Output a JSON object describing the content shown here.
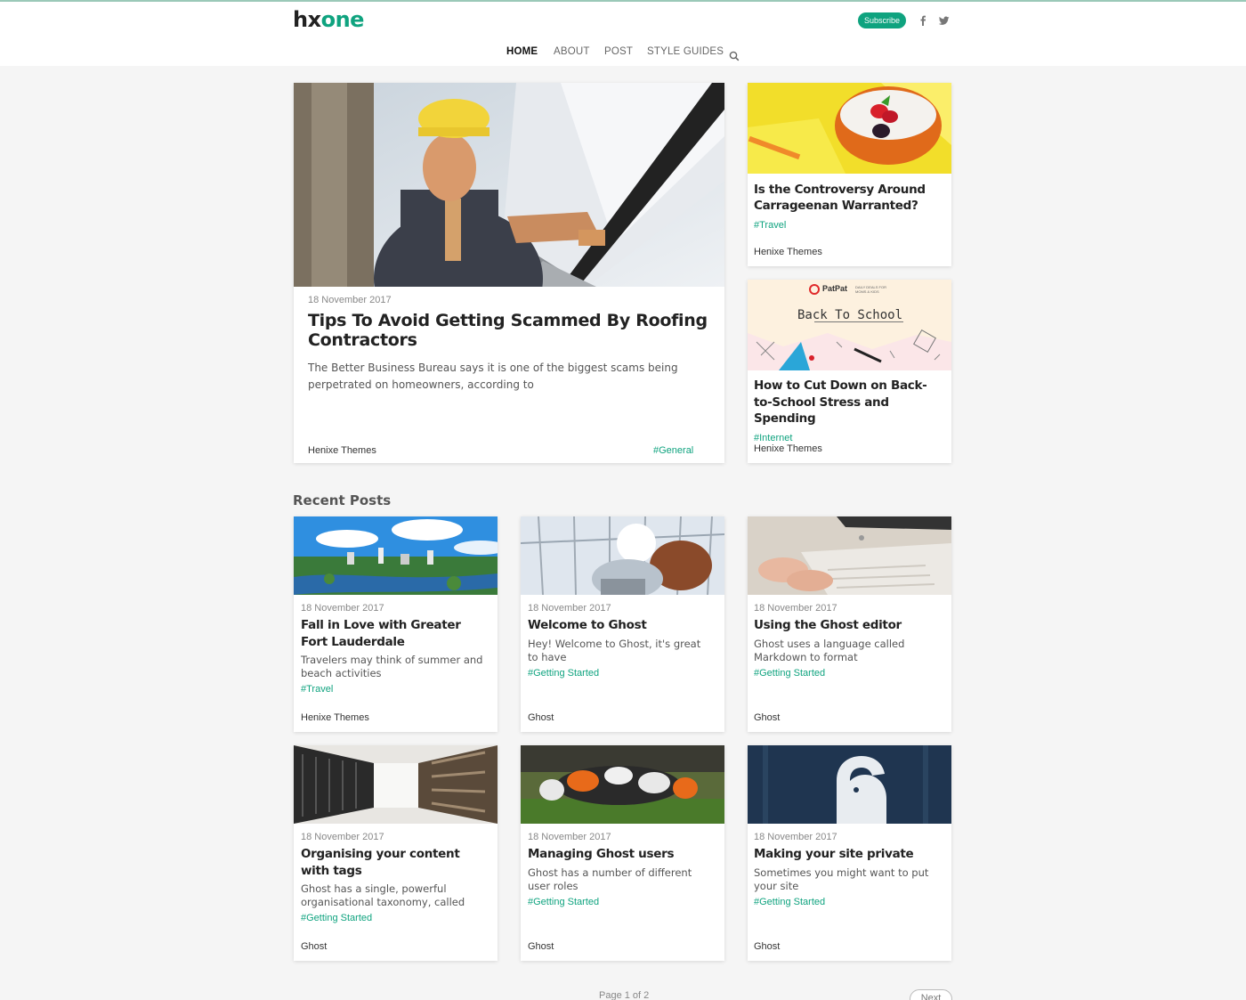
{
  "brand": {
    "logo_part1": "hx",
    "logo_part2": "one"
  },
  "header": {
    "subscribe_label": "Subscribe",
    "social": [
      {
        "icon": "facebook-icon",
        "glyph": "f"
      },
      {
        "icon": "twitter-icon",
        "glyph": "t"
      }
    ]
  },
  "nav": {
    "items": [
      "HOME",
      "ABOUT",
      "POST",
      "STYLE GUIDES"
    ],
    "active": "HOME",
    "search_icon": "search-icon"
  },
  "featured": {
    "main": {
      "date": "18 November 2017",
      "title_line1": "Tips To Avoid Getting Scammed By Roofing",
      "title_line2": "Contractors",
      "excerpt_line1": "The Better Business Bureau says it is one of the biggest scams being",
      "excerpt_line2": "perpetrated on homeowners, according to",
      "author": "Henixe Themes",
      "tag": "#General"
    },
    "side": [
      {
        "title_line1": "Is the Controversy Around",
        "title_line2": "Carrageenan Warranted?",
        "tag": "#Travel",
        "author": "Henixe Themes"
      },
      {
        "image_text_brand": "PatPat",
        "image_text_tagline": "DAILY DEALS FOR MOMS & KIDS",
        "image_text": "Back To School",
        "title_line1": "How to Cut Down on Back-",
        "title_line2": "to-School Stress and",
        "title_line3": "Spending",
        "tag": "#Internet",
        "author": "Henixe Themes"
      }
    ]
  },
  "recent": {
    "heading": "Recent Posts",
    "posts": [
      {
        "date": "18 November 2017",
        "title_line1": "Fall in Love with Greater",
        "title_line2": "Fort Lauderdale",
        "excerpt_line1": "Travelers may think of summer and",
        "excerpt_line2": "beach activities",
        "tag": "#Travel",
        "author": "Henixe Themes"
      },
      {
        "date": "18 November 2017",
        "title_line1": "Welcome to Ghost",
        "excerpt_line1": "Hey! Welcome to Ghost, it's great",
        "excerpt_line2": "to have",
        "tag": "#Getting Started",
        "author": "Ghost"
      },
      {
        "date": "18 November 2017",
        "title_line1": "Using the Ghost editor",
        "excerpt_line1": "Ghost uses a language called",
        "excerpt_line2": "Markdown to format",
        "tag": "#Getting Started",
        "author": "Ghost"
      },
      {
        "date": "18 November 2017",
        "title_line1": "Organising your content",
        "title_line2": "with tags",
        "excerpt_line1": "Ghost has a single, powerful",
        "excerpt_line2": "organisational taxonomy, called",
        "tag": "#Getting Started",
        "author": "Ghost"
      },
      {
        "date": "18 November 2017",
        "title_line1": "Managing Ghost users",
        "excerpt_line1": "Ghost has a number of different",
        "excerpt_line2": "user roles",
        "tag": "#Getting Started",
        "author": "Ghost"
      },
      {
        "date": "18 November 2017",
        "title_line1": "Making your site private",
        "excerpt_line1": "Sometimes you might want to put",
        "excerpt_line2": "your site",
        "tag": "#Getting Started",
        "author": "Ghost"
      }
    ]
  },
  "pagination": {
    "label": "Page 1 of 2",
    "next_label": "Next"
  },
  "colors": {
    "accent": "#0fa37f",
    "background": "#f5f5f5"
  }
}
